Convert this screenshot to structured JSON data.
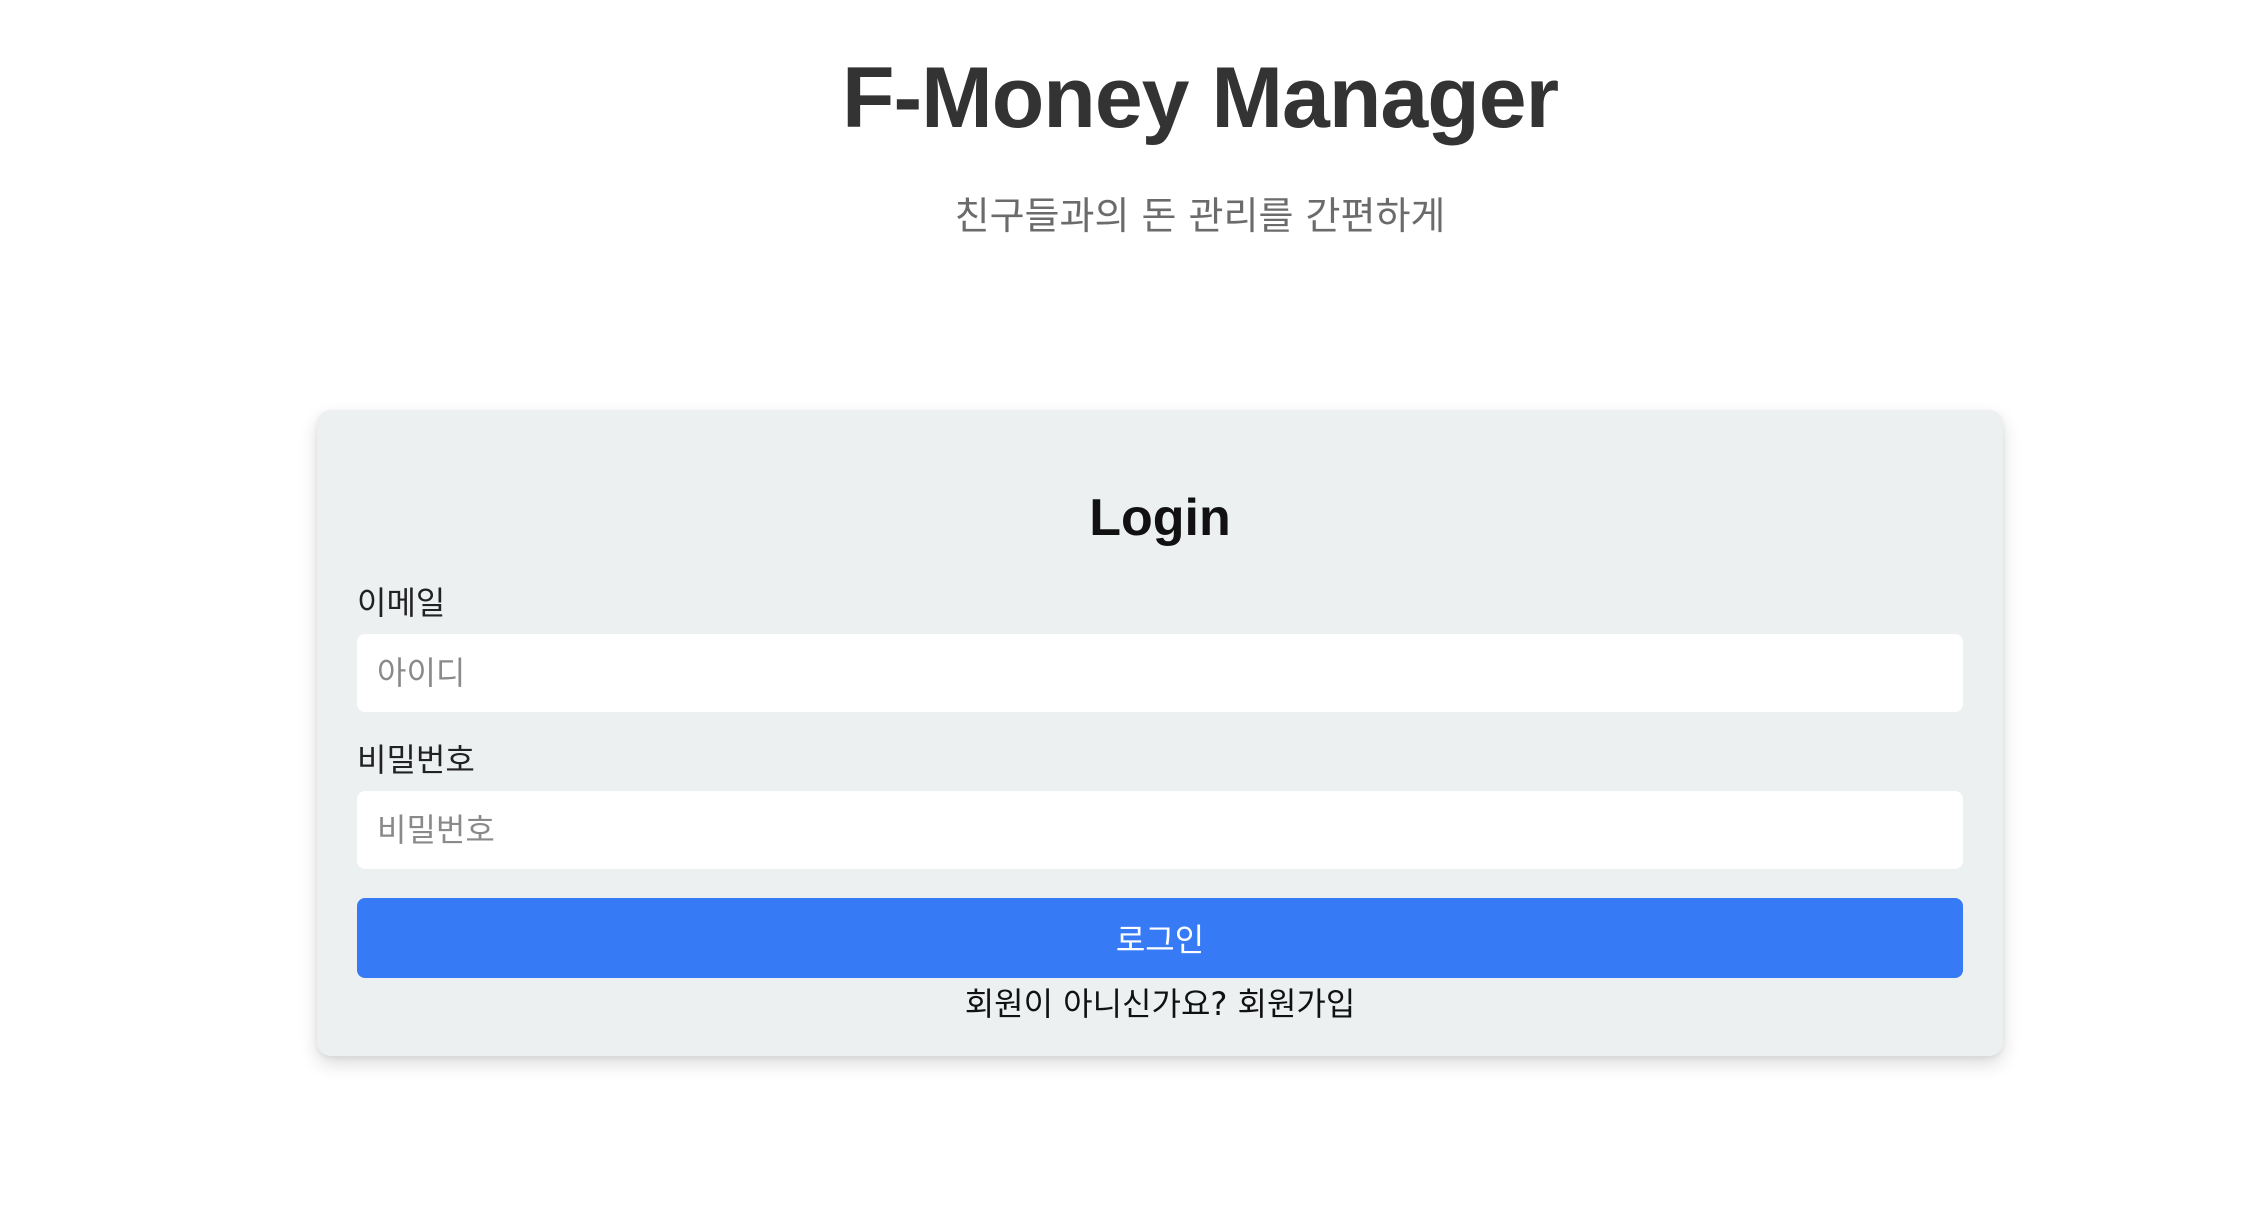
{
  "header": {
    "title": "F-Money Manager",
    "subtitle": "친구들과의 돈 관리를 간편하게"
  },
  "login": {
    "title": "Login",
    "email_label": "이메일",
    "email_placeholder": "아이디",
    "email_value": "",
    "password_label": "비밀번호",
    "password_placeholder": "비밀번호",
    "password_value": "",
    "submit_label": "로그인",
    "signup_prompt": "회원이 아니신가요?",
    "signup_link": "회원가입"
  },
  "colors": {
    "card_background": "#ecf0f1",
    "primary_button": "#377af5",
    "title_text": "#333333",
    "subtitle_text": "#6b6b6b"
  }
}
